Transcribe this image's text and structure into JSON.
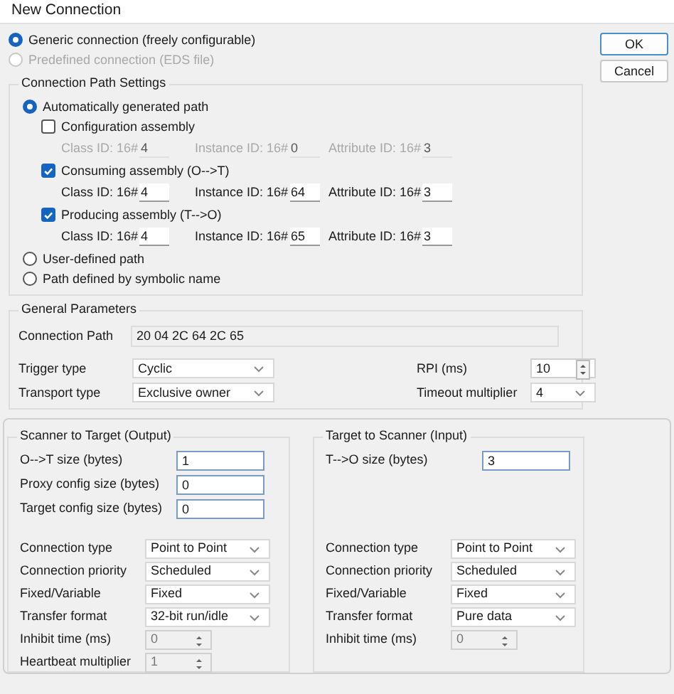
{
  "window": {
    "title": "New Connection"
  },
  "connection_modes": [
    {
      "label": "Generic connection (freely configurable)",
      "selected": true,
      "disabled": false
    },
    {
      "label": "Predefined connection (EDS file)",
      "selected": false,
      "disabled": true
    }
  ],
  "buttons": [
    "OK",
    "Cancel"
  ],
  "path_settings": {
    "title": "Connection Path Settings",
    "options": [
      {
        "label": "Automatically generated path",
        "selected": true,
        "assemblies": [
          {
            "label": "Configuration assembly",
            "checked": false,
            "fields": [
              {
                "label": "Class ID: 16#",
                "value": "4"
              },
              {
                "label": "Instance ID: 16#",
                "value": "0"
              },
              {
                "label": "Attribute ID: 16#",
                "value": "3"
              }
            ]
          },
          {
            "label": "Consuming assembly (O-->T)",
            "checked": true,
            "fields": [
              {
                "label": "Class ID: 16#",
                "value": "4"
              },
              {
                "label": "Instance ID: 16#",
                "value": "64"
              },
              {
                "label": "Attribute ID: 16#",
                "value": "3"
              }
            ]
          },
          {
            "label": "Producing assembly (T-->O)",
            "checked": true,
            "fields": [
              {
                "label": "Class ID: 16#",
                "value": "4"
              },
              {
                "label": "Instance ID: 16#",
                "value": "65"
              },
              {
                "label": "Attribute ID: 16#",
                "value": "3"
              }
            ]
          }
        ]
      },
      {
        "label": "User-defined path",
        "selected": false
      },
      {
        "label": "Path defined by symbolic name",
        "selected": false
      }
    ]
  },
  "general": {
    "title": "General Parameters",
    "connection_path": {
      "label": "Connection Path",
      "value": "20 04 2C 64 2C 65"
    },
    "params": [
      {
        "label": "Trigger type",
        "kind": "select",
        "value": "Cyclic"
      },
      {
        "label": "RPI (ms)",
        "kind": "spinner",
        "value": "10",
        "disabled": false
      },
      {
        "label": "Transport type",
        "kind": "select",
        "value": "Exclusive owner"
      },
      {
        "label": "Timeout multiplier",
        "kind": "select",
        "value": "4"
      }
    ]
  },
  "panels": [
    {
      "title": "Scanner to Target (Output)",
      "sizes": [
        {
          "label": "O-->T size (bytes)",
          "value": "1"
        },
        {
          "label": "Proxy config size (bytes)",
          "value": "0"
        },
        {
          "label": "Target config size (bytes)",
          "value": "0"
        }
      ],
      "settings": [
        {
          "label": "Connection type",
          "kind": "select",
          "value": "Point to Point"
        },
        {
          "label": "Connection priority",
          "kind": "select",
          "value": "Scheduled"
        },
        {
          "label": "Fixed/Variable",
          "kind": "select",
          "value": "Fixed"
        },
        {
          "label": "Transfer format",
          "kind": "select",
          "value": "32-bit run/idle"
        },
        {
          "label": "Inhibit time (ms)",
          "kind": "spinner",
          "value": "0",
          "disabled": true
        },
        {
          "label": "Heartbeat multiplier",
          "kind": "spinner",
          "value": "1",
          "disabled": true
        }
      ]
    },
    {
      "title": "Target to Scanner (Input)",
      "sizes": [
        {
          "label": "T-->O size (bytes)",
          "value": "3"
        }
      ],
      "settings": [
        {
          "label": "Connection type",
          "kind": "select",
          "value": "Point to Point"
        },
        {
          "label": "Connection priority",
          "kind": "select",
          "value": "Scheduled"
        },
        {
          "label": "Fixed/Variable",
          "kind": "select",
          "value": "Fixed"
        },
        {
          "label": "Transfer format",
          "kind": "select",
          "value": "Pure data"
        },
        {
          "label": "Inhibit time (ms)",
          "kind": "spinner",
          "value": "0",
          "disabled": true
        }
      ]
    }
  ]
}
